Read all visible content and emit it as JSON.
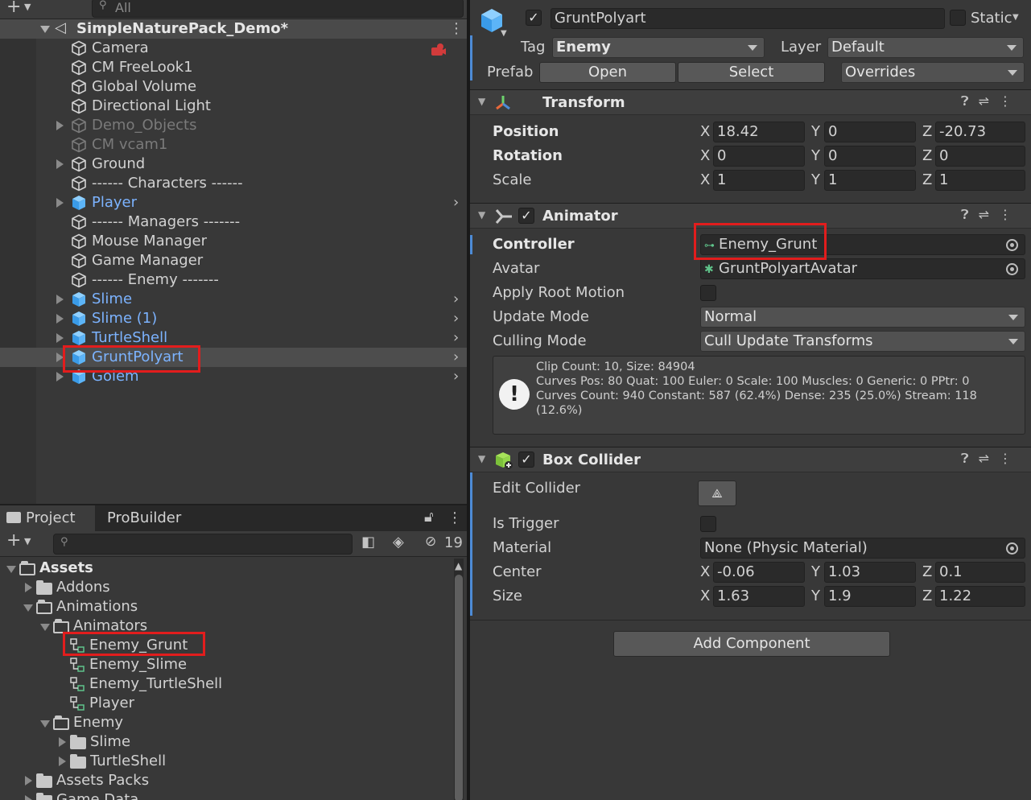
{
  "hierarchy": {
    "search_placeholder": "All",
    "scene_name": "SimpleNaturePack_Demo*",
    "items": [
      {
        "label": "Camera",
        "type": "plain",
        "indent": 0
      },
      {
        "label": "CM FreeLook1",
        "type": "plain"
      },
      {
        "label": "Global Volume",
        "type": "plain"
      },
      {
        "label": "Directional Light",
        "type": "plain"
      },
      {
        "label": "Demo_Objects",
        "type": "disabled"
      },
      {
        "label": "CM vcam1",
        "type": "disabled"
      },
      {
        "label": "Ground",
        "type": "plain"
      },
      {
        "label": "------ Characters ------",
        "type": "plain"
      },
      {
        "label": "Player",
        "type": "prefab"
      },
      {
        "label": "------ Managers -------",
        "type": "plain"
      },
      {
        "label": "Mouse Manager",
        "type": "plain"
      },
      {
        "label": "Game Manager",
        "type": "plain"
      },
      {
        "label": "------ Enemy -------",
        "type": "plain"
      },
      {
        "label": "Slime",
        "type": "prefab"
      },
      {
        "label": "Slime (1)",
        "type": "prefab"
      },
      {
        "label": "TurtleShell",
        "type": "prefab"
      },
      {
        "label": "GruntPolyart",
        "type": "prefab-selected"
      },
      {
        "label": "Golem",
        "type": "prefab"
      }
    ]
  },
  "project": {
    "tabs": [
      "Project",
      "ProBuilder"
    ],
    "hidden_count": "19",
    "tree": [
      {
        "label": "Assets",
        "kind": "folder-open",
        "bold": true
      },
      {
        "label": "Addons",
        "kind": "folder"
      },
      {
        "label": "Animations",
        "kind": "folder-open"
      },
      {
        "label": "Animators",
        "kind": "folder-open"
      },
      {
        "label": "Enemy_Grunt",
        "kind": "animator"
      },
      {
        "label": "Enemy_Slime",
        "kind": "animator"
      },
      {
        "label": "Enemy_TurtleShell",
        "kind": "animator"
      },
      {
        "label": "Player",
        "kind": "animator"
      },
      {
        "label": "Enemy",
        "kind": "folder-open"
      },
      {
        "label": "Slime",
        "kind": "folder"
      },
      {
        "label": "TurtleShell",
        "kind": "folder"
      },
      {
        "label": "Assets Packs",
        "kind": "folder"
      },
      {
        "label": "Game Data",
        "kind": "folder"
      }
    ]
  },
  "inspector": {
    "object_name": "GruntPolyart",
    "static_label": "Static",
    "tag_label": "Tag",
    "tag_value": "Enemy",
    "layer_label": "Layer",
    "layer_value": "Default",
    "prefab_label": "Prefab",
    "prefab_open": "Open",
    "prefab_select": "Select",
    "prefab_overrides": "Overrides",
    "transform": {
      "title": "Transform",
      "position_label": "Position",
      "position": {
        "x": "18.42",
        "y": "0",
        "z": "-20.73"
      },
      "rotation_label": "Rotation",
      "rotation": {
        "x": "0",
        "y": "0",
        "z": "0"
      },
      "scale_label": "Scale",
      "scale": {
        "x": "1",
        "y": "1",
        "z": "1"
      }
    },
    "animator": {
      "title": "Animator",
      "controller_label": "Controller",
      "controller_value": "Enemy_Grunt",
      "avatar_label": "Avatar",
      "avatar_value": "GruntPolyartAvatar",
      "root_motion_label": "Apply Root Motion",
      "update_mode_label": "Update Mode",
      "update_mode_value": "Normal",
      "culling_mode_label": "Culling Mode",
      "culling_mode_value": "Cull Update Transforms",
      "info_line1": "Clip Count: 10, Size: 84904",
      "info_line2": "Curves Pos: 80 Quat: 100 Euler: 0 Scale: 100 Muscles: 0 Generic: 0 PPtr: 0",
      "info_line3": "Curves Count: 940 Constant: 587 (62.4%) Dense: 235 (25.0%) Stream: 118",
      "info_line4": "(12.6%)"
    },
    "box_collider": {
      "title": "Box Collider",
      "edit_label": "Edit Collider",
      "trigger_label": "Is Trigger",
      "material_label": "Material",
      "material_value": "None (Physic Material)",
      "center_label": "Center",
      "center": {
        "x": "-0.06",
        "y": "1.03",
        "z": "0.1"
      },
      "size_label": "Size",
      "size": {
        "x": "1.63",
        "y": "1.9",
        "z": "1.22"
      }
    },
    "add_component": "Add Component",
    "axis_x": "X",
    "axis_y": "Y",
    "axis_z": "Z"
  },
  "colors": {
    "accent_blue": "#4d8bd6",
    "prefab_text": "#7cb3ff",
    "highlight_red": "#e21d1d"
  }
}
